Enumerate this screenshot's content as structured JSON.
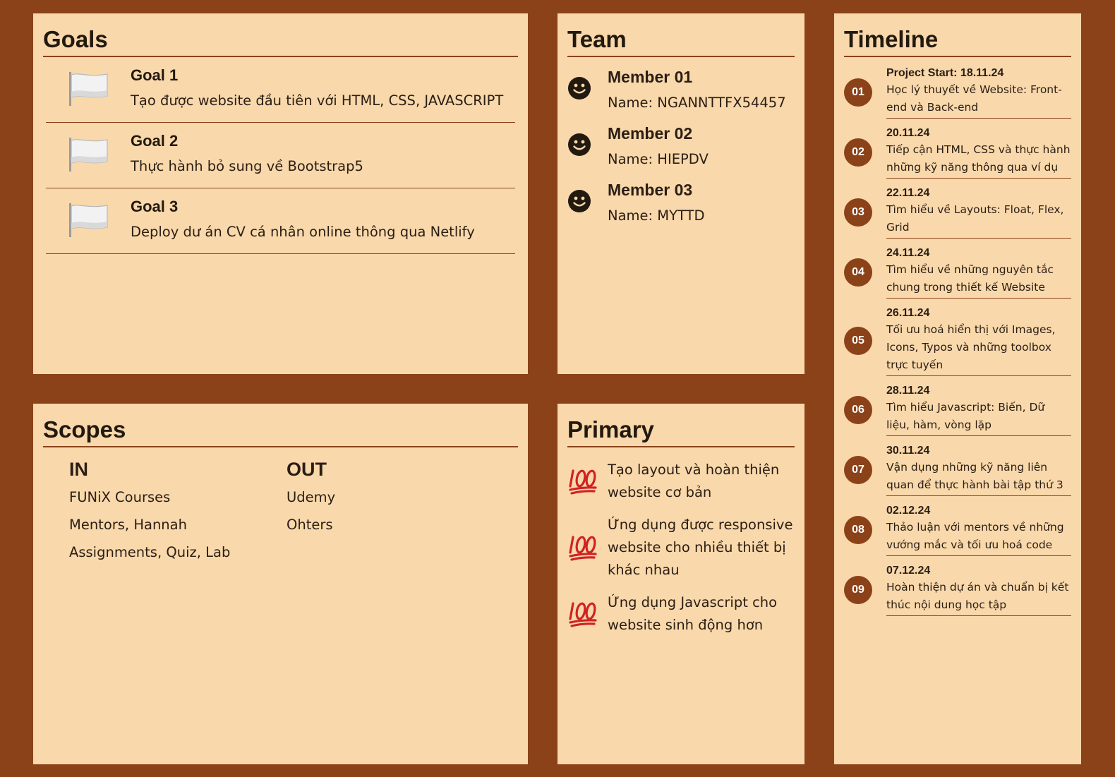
{
  "goals": {
    "title": "Goals",
    "items": [
      {
        "title": "Goal 1",
        "desc": "Tạo được website đầu tiên với HTML, CSS, JAVASCRIPT",
        "icon": "white-flag-icon"
      },
      {
        "title": "Goal 2",
        "desc": "Thực hành bỏ sung về Bootstrap5",
        "icon": "white-flag-icon"
      },
      {
        "title": "Goal 3",
        "desc": "Deploy dư án CV cá nhân online thông qua Netlify",
        "icon": "white-flag-icon"
      }
    ]
  },
  "team": {
    "title": "Team",
    "members": [
      {
        "title": "Member 01",
        "name": "Name: NGANNTTFX54457",
        "icon": "smiley-icon"
      },
      {
        "title": "Member 02",
        "name": "Name: HIEPDV",
        "icon": "smiley-icon"
      },
      {
        "title": "Member 03",
        "name": "Name: MYTTD",
        "icon": "smiley-icon"
      }
    ]
  },
  "scopes": {
    "title": "Scopes",
    "in": {
      "heading": "IN",
      "items": [
        "FUNiX Courses",
        "Mentors, Hannah",
        "Assignments, Quiz, Lab"
      ]
    },
    "out": {
      "heading": "OUT",
      "items": [
        "Udemy",
        "Ohters"
      ]
    }
  },
  "primary": {
    "title": "Primary",
    "items": [
      {
        "text": "Tạo layout và hoàn thiện website cơ bản",
        "icon": "hundred-points-icon"
      },
      {
        "text": "Ứng dụng được responsive website cho nhiều thiết bị khác nhau",
        "icon": "hundred-points-icon"
      },
      {
        "text": "Ứng dụng Javascript cho website sinh động hơn",
        "icon": "hundred-points-icon"
      }
    ]
  },
  "timeline": {
    "title": "Timeline",
    "items": [
      {
        "num": "01",
        "date": "Project Start: 18.11.24",
        "desc": "Học lý thuyết về Website: Front-end và Back-end"
      },
      {
        "num": "02",
        "date": "20.11.24",
        "desc": "Tiếp cận HTML, CSS và thực hành những kỹ năng thông qua ví dụ"
      },
      {
        "num": "03",
        "date": "22.11.24",
        "desc": "Tìm hiểu về Layouts: Float, Flex, Grid"
      },
      {
        "num": "04",
        "date": "24.11.24",
        "desc": "Tìm hiểu về những nguyên tắc chung trong thiết kế Website"
      },
      {
        "num": "05",
        "date": "26.11.24",
        "desc": "Tối ưu hoá hiển thị với Images, Icons, Typos và những toolbox trực tuyến"
      },
      {
        "num": "06",
        "date": "28.11.24",
        "desc": "Tìm hiểu Javascript: Biến, Dữ liệu, hàm, vòng lặp"
      },
      {
        "num": "07",
        "date": "30.11.24",
        "desc": "Vận dụng những kỹ năng liên quan để thực hành bài tập thứ 3"
      },
      {
        "num": "08",
        "date": "02.12.24",
        "desc": "Thảo luận với mentors về những vướng mắc và tối ưu hoá code"
      },
      {
        "num": "09",
        "date": "07.12.24",
        "desc": "Hoàn thiện dự án và chuẩn bị kết thúc nội dung học tập"
      }
    ]
  },
  "colors": {
    "background": "#8b4219",
    "panel": "#f9d8ab",
    "accent": "#8b4219",
    "text": "#2a1e14"
  }
}
